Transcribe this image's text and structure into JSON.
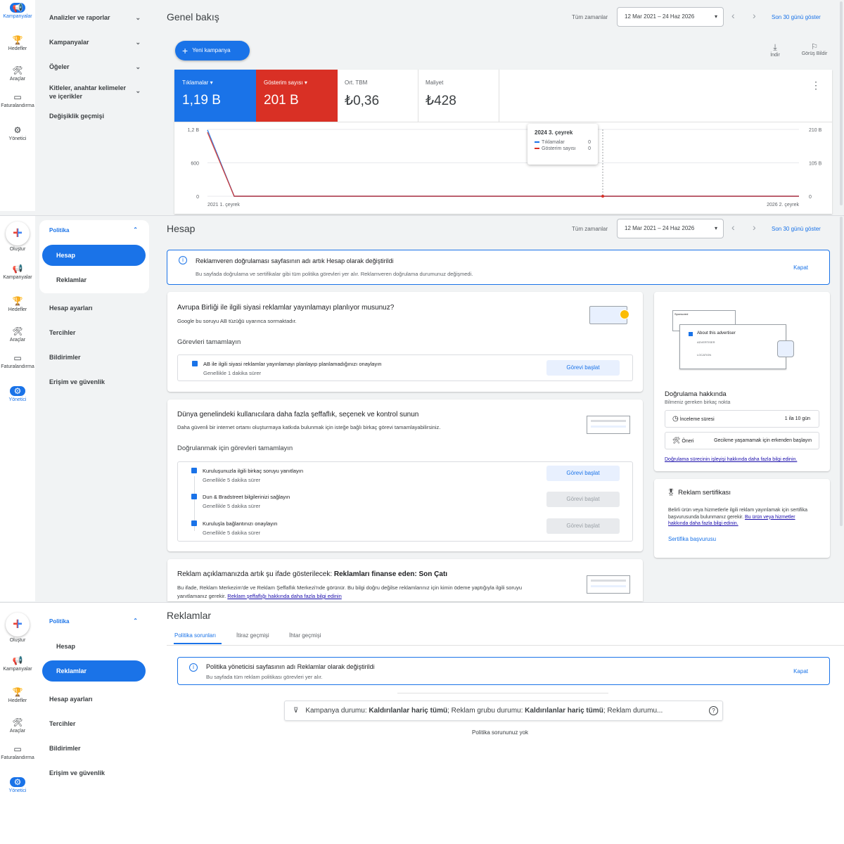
{
  "rail1": {
    "items": [
      {
        "label": "Kampanyalar",
        "icon": "megaphone-icon",
        "glyph": "📢"
      },
      {
        "label": "Hedefler",
        "icon": "trophy-icon",
        "glyph": "🏆"
      },
      {
        "label": "Araçlar",
        "icon": "tools-icon",
        "glyph": "🛠"
      },
      {
        "label": "Faturalandırma",
        "icon": "billing-icon",
        "glyph": "▭"
      },
      {
        "label": "Yönetici",
        "icon": "gear-icon",
        "glyph": "⚙"
      }
    ]
  },
  "rail2": {
    "create": "Oluştur",
    "items": [
      {
        "label": "Kampanyalar",
        "glyph": "📢"
      },
      {
        "label": "Hedefler",
        "glyph": "🏆"
      },
      {
        "label": "Araçlar",
        "glyph": "🛠"
      },
      {
        "label": "Faturalandırma",
        "glyph": "▭"
      },
      {
        "label": "Yönetici",
        "glyph": "⚙"
      }
    ]
  },
  "nav1": {
    "items": [
      "Analizler ve raporlar",
      "Kampanyalar",
      "Öğeler",
      "Kitleler, anahtar kelimeler ve içerikler",
      "Değişiklik geçmişi"
    ]
  },
  "nav2": {
    "group": "Politika",
    "sub": [
      "Hesap",
      "Reklamlar"
    ],
    "items": [
      "Hesap ayarları",
      "Tercihler",
      "Bildirimler",
      "Erişim ve güvenlik"
    ]
  },
  "overview": {
    "title": "Genel bakış",
    "date_label": "Tüm zamanlar",
    "date_range": "12 Mar 2021 – 24 Haz 2026",
    "last30": "Son 30 günü göster",
    "new_campaign": "Yeni kampanya",
    "download": "İndir",
    "feedback": "Görüş Bildir",
    "metrics": [
      {
        "label": "Tıklamalar",
        "value": "1,19 B",
        "color": "#1a73e8"
      },
      {
        "label": "Gösterim sayısı",
        "value": "201 B",
        "color": "#d93025"
      },
      {
        "label": "Ort. TBM",
        "value": "₺0,36"
      },
      {
        "label": "Maliyet",
        "value": "₺428"
      }
    ],
    "tooltip": {
      "title": "2024 3. çeyrek",
      "rows": [
        {
          "label": "Tıklamalar",
          "value": "0"
        },
        {
          "label": "Gösterim sayısı",
          "value": "0"
        }
      ]
    }
  },
  "chart_data": {
    "type": "line",
    "x": [
      "2021 1. çeyrek",
      "2021 2. çeyrek",
      "2024 3. çeyrek",
      "2026 2. çeyrek"
    ],
    "series": [
      {
        "name": "Tıklamalar",
        "values": [
          1190,
          0,
          0,
          0
        ],
        "color": "#1a73e8",
        "axis": "left"
      },
      {
        "name": "Gösterim sayısı",
        "values": [
          201,
          0,
          0,
          0
        ],
        "color": "#d93025",
        "axis": "right"
      }
    ],
    "left_ticks": [
      "1,2 B",
      "600",
      "0"
    ],
    "right_ticks": [
      "210 B",
      "105 B",
      "0"
    ],
    "xticks": [
      "2021 1. çeyrek",
      "2026 2. çeyrek"
    ],
    "left_ylim": [
      0,
      1200
    ],
    "right_ylim": [
      0,
      210
    ]
  },
  "hesap": {
    "title": "Hesap",
    "date_label": "Tüm zamanlar",
    "date_range": "12 Mar 2021 – 24 Haz 2026",
    "last30": "Son 30 günü göster",
    "banner_title": "Reklamveren doğrulaması sayfasının adı artık Hesap olarak değiştirildi",
    "banner_text": "Bu sayfada doğrulama ve sertifikalar gibi tüm politika görevleri yer alır. Reklamveren doğrulama durumunuz değişmedi.",
    "dismiss": "Kapat",
    "card1": {
      "title": "Avrupa Birliği ile ilgili siyasi reklamlar yayınlamayı planlıyor musunuz?",
      "sub": "Google bu soruyu AB tüzüğü uyarınca sormaktadır.",
      "tasks_title": "Görevleri tamamlayın",
      "task": {
        "name": "AB ile ilgili siyasi reklamlar yayınlamayı planlayıp planlamadığınızı onaylayın",
        "time": "Genellikle 1 dakika sürer",
        "btn": "Görevi başlat"
      }
    },
    "card2": {
      "title": "Dünya genelindeki kullanıcılara daha fazla şeffaflık, seçenek ve kontrol sunun",
      "sub": "Daha güvenli bir internet ortamı oluşturmaya katkıda bulunmak için isteğe bağlı birkaç görevi tamamlayabilirsiniz.",
      "tasks_title": "Doğrulanmak için görevleri tamamlayın",
      "tasks": [
        {
          "name": "Kuruluşunuzla ilgili birkaç soruyu yanıtlayın",
          "time": "Genellikle 5 dakika sürer",
          "btn": "Görevi başlat"
        },
        {
          "name": "Dun & Bradstreet bilgilerinizi sağlayın",
          "time": "Genellikle 5 dakika sürer",
          "btn": "Görevi başlat"
        },
        {
          "name": "Kuruluşla bağlantınızı onaylayın",
          "time": "Genellikle 5 dakika sürer",
          "btn": "Görevi başlat"
        }
      ]
    },
    "card3": {
      "title_pre": "Reklam açıklamanızda artık şu ifade gösterilecek: ",
      "title_bold": "Reklamları finanse eden: Son Çatı",
      "text": "Bu ifade, Reklam Merkezim'de ve Reklam Şeffaflık Merkezi'nde görünür. Bu bilgi doğru değilse reklamlarınız için kimin ödeme yaptığıyla ilgili soruyu yanıtlamanız gerekir. ",
      "link": "Reklam şeffaflığı hakkında daha fazla bilgi edinin"
    },
    "side1": {
      "sponsored": "Sponsored",
      "about": "About this advertiser",
      "advertiser": "ADVERTISER",
      "location": "LOCATION",
      "title": "Doğrulama hakkında",
      "sub": "Bilmeniz gereken birkaç nokta",
      "row1_label": "İnceleme süresi",
      "row1_value": "1 ila 10 gün",
      "row2_label": "Öneri",
      "row2_value": "Gecikme yaşamamak için erkenden başlayın",
      "link": "Doğrulama sürecinin işleyişi hakkında daha fazla bilgi edinin."
    },
    "side2": {
      "title": "Reklam sertifikası",
      "text": "Belirli ürün veya hizmetlerle ilgili reklam yayınlamak için sertifika başvurusunda bulunmanız gerekir. ",
      "link": "Bu ürün veya hizmetler hakkında daha fazla bilgi edinin.",
      "apply": "Sertifika başvurusu"
    }
  },
  "ads": {
    "title": "Reklamlar",
    "tabs": [
      "Politika sorunları",
      "İtiraz geçmişi",
      "İhtar geçmişi"
    ],
    "banner_title": "Politika yöneticisi sayfasının adı Reklamlar olarak değiştirildi",
    "banner_text": "Bu sayfada tüm reklam politikası görevleri yer alır.",
    "dismiss": "Kapat",
    "filter": {
      "k1": "Kampanya durumu: ",
      "v1": "Kaldırılanlar hariç tümü",
      "k2": "Reklam grubu durumu: ",
      "v2": "Kaldırılanlar hariç tümü",
      "k3": "Reklam durumu..."
    },
    "empty": "Politika sorununuz yok"
  },
  "colors": {
    "accent": "#1a73e8",
    "red": "#d93025"
  }
}
